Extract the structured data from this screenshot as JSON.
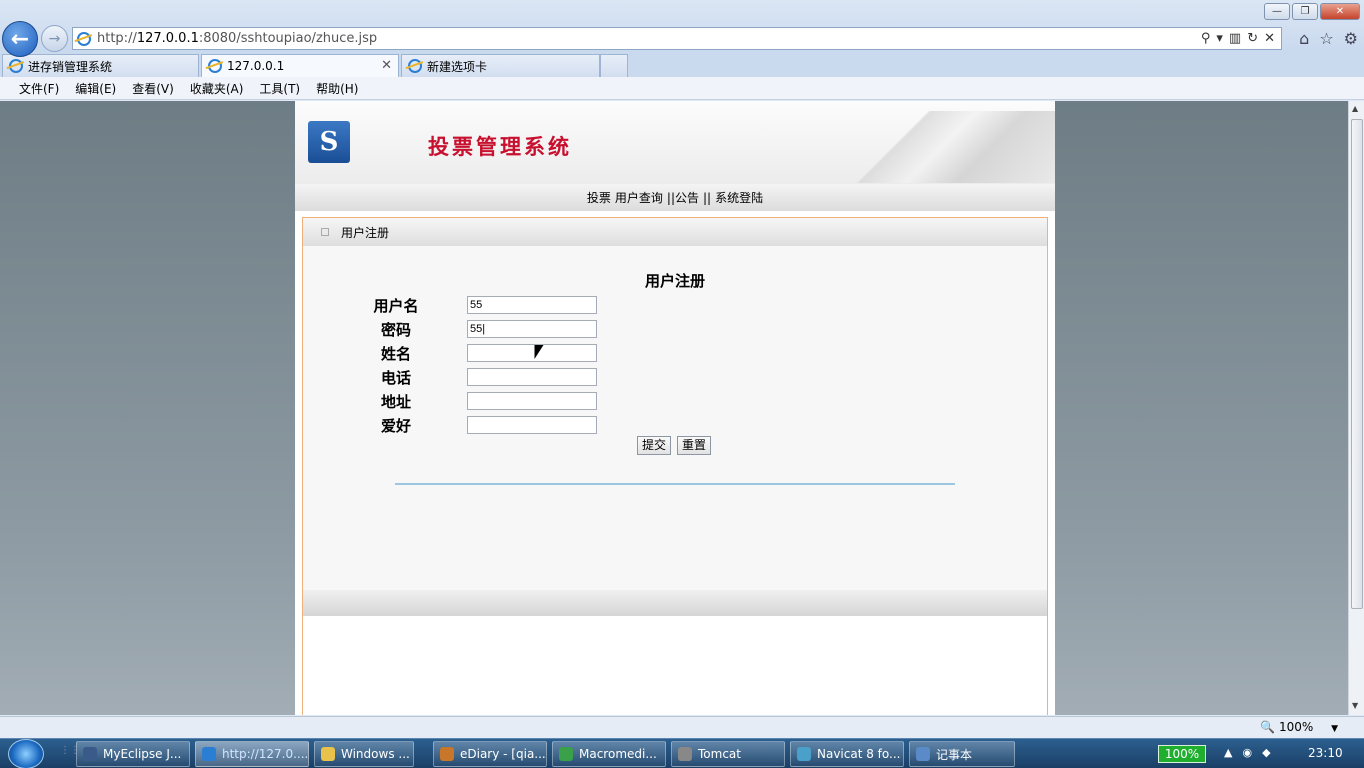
{
  "browser": {
    "address": {
      "prefix": "http://",
      "host": "127.0.0.1",
      "rest": ":8080/sshtoupiao/zhuce.jsp"
    },
    "tabs": [
      {
        "label": "进存销管理系统"
      },
      {
        "label": "127.0.0.1"
      },
      {
        "label": "新建选项卡"
      }
    ],
    "menu": [
      "文件(F)",
      "编辑(E)",
      "查看(V)",
      "收藏夹(A)",
      "工具(T)",
      "帮助(H)"
    ],
    "zoom": "100%"
  },
  "page": {
    "site_title": "投票管理系统",
    "nav": [
      "投票",
      "用户查询",
      "||公告",
      "||",
      "系统登陆"
    ],
    "section_title": "用户注册",
    "form": {
      "title": "用户注册",
      "fields": [
        {
          "label": "用户名",
          "value": "55"
        },
        {
          "label": "密码",
          "value": "55|"
        },
        {
          "label": "姓名",
          "value": ""
        },
        {
          "label": "电话",
          "value": ""
        },
        {
          "label": "地址",
          "value": ""
        },
        {
          "label": "爱好",
          "value": ""
        }
      ],
      "submit_label": "提交",
      "reset_label": "重置"
    }
  },
  "taskbar": {
    "items": [
      {
        "label": "MyEclipse J...",
        "color": "#3a5a8a"
      },
      {
        "label": "http://127.0....",
        "color": "#2a7fd4"
      },
      {
        "label": "Windows ...",
        "color": "#e8c24a"
      },
      {
        "label": "eDiary - [qia...",
        "color": "#c8762a"
      },
      {
        "label": "Macromedi...",
        "color": "#3aa04a"
      },
      {
        "label": "Tomcat",
        "color": "#888888"
      },
      {
        "label": "Navicat 8 fo...",
        "color": "#4aa0c8"
      },
      {
        "label": "记事本",
        "color": "#5a8ac8"
      }
    ],
    "battery": "100%",
    "clock": "23:10"
  }
}
